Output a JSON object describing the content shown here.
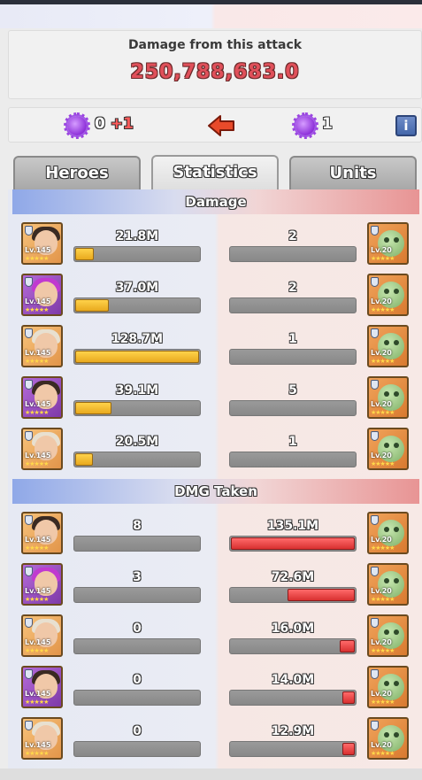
{
  "damage_panel": {
    "label": "Damage from this attack",
    "value": "250,788,683.0"
  },
  "score": {
    "left_value": "0",
    "left_plus": "+1",
    "right_value": "1",
    "info_label": "i",
    "virus_color": "#9b45e0"
  },
  "tabs": [
    {
      "label": "Heroes"
    },
    {
      "label": "Statistics",
      "active": true
    },
    {
      "label": "Units"
    }
  ],
  "sections": {
    "damage_title": "Damage",
    "taken_title": "DMG Taken"
  },
  "damage_rows": [
    {
      "hero_level": "Lv.145",
      "hero_value": "21.8M",
      "hero_fill": 0.15,
      "unit_level": "Lv.20",
      "unit_value": "2",
      "unit_fill": 0
    },
    {
      "hero_level": "Lv.145",
      "hero_value": "37.0M",
      "hero_fill": 0.27,
      "unit_level": "Lv.20",
      "unit_value": "2",
      "unit_fill": 0
    },
    {
      "hero_level": "Lv.145",
      "hero_value": "128.7M",
      "hero_fill": 1.0,
      "unit_level": "Lv.20",
      "unit_value": "1",
      "unit_fill": 0
    },
    {
      "hero_level": "Lv.145",
      "hero_value": "39.1M",
      "hero_fill": 0.29,
      "unit_level": "Lv.20",
      "unit_value": "5",
      "unit_fill": 0
    },
    {
      "hero_level": "Lv.145",
      "hero_value": "20.5M",
      "hero_fill": 0.14,
      "unit_level": "Lv.20",
      "unit_value": "1",
      "unit_fill": 0
    }
  ],
  "taken_rows": [
    {
      "hero_level": "Lv.145",
      "hero_value": "8",
      "hero_fill": 0,
      "unit_level": "Lv.20",
      "unit_value": "135.1M",
      "unit_fill": 1.0
    },
    {
      "hero_level": "Lv.145",
      "hero_value": "3",
      "hero_fill": 0,
      "unit_level": "Lv.20",
      "unit_value": "72.6M",
      "unit_fill": 0.54
    },
    {
      "hero_level": "Lv.145",
      "hero_value": "0",
      "hero_fill": 0,
      "unit_level": "Lv.20",
      "unit_value": "16.0M",
      "unit_fill": 0.12
    },
    {
      "hero_level": "Lv.145",
      "hero_value": "0",
      "hero_fill": 0,
      "unit_level": "Lv.20",
      "unit_value": "14.0M",
      "unit_fill": 0.1
    },
    {
      "hero_level": "Lv.145",
      "hero_value": "0",
      "hero_fill": 0,
      "unit_level": "Lv.20",
      "unit_value": "12.9M",
      "unit_fill": 0.1
    }
  ],
  "portrait_stars": "★★★★★",
  "colors": {
    "hero_bar": "#e8a91e",
    "unit_bar": "#d83030",
    "damage_value": "#e0505a"
  }
}
